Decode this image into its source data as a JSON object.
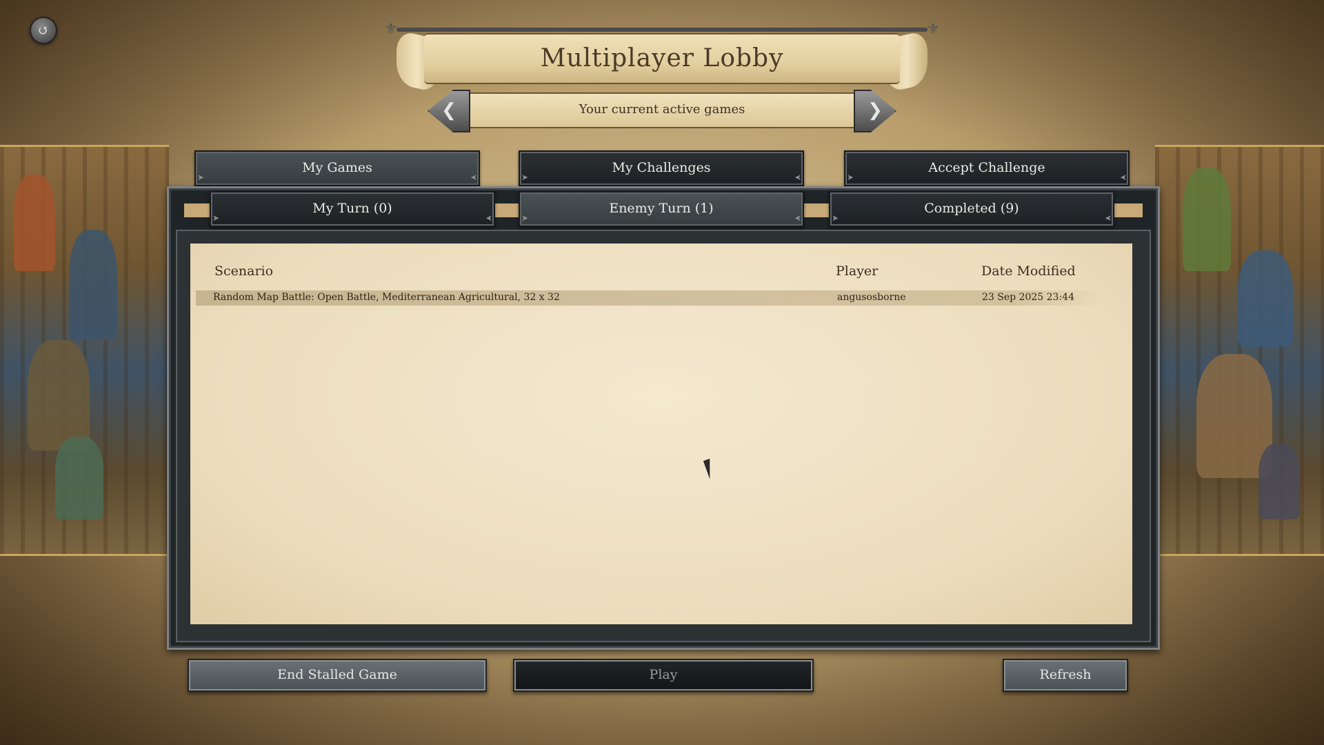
{
  "header": {
    "title": "Multiplayer Lobby",
    "subtitle": "Your current active games"
  },
  "main_tabs": [
    {
      "label": "My Games"
    },
    {
      "label": "My Challenges"
    },
    {
      "label": "Accept Challenge"
    }
  ],
  "sub_tabs": [
    {
      "label": "My Turn (0)"
    },
    {
      "label": "Enemy Turn (1)"
    },
    {
      "label": "Completed (9)"
    }
  ],
  "table": {
    "columns": [
      "Scenario",
      "Player",
      "Date Modified"
    ],
    "rows": [
      {
        "scenario": "Random Map Battle: Open Battle, Mediterranean Agricultural, 32 x 32",
        "player": "angusosborne",
        "date": "23 Sep 2025 23:44"
      }
    ]
  },
  "buttons": {
    "end_stalled": "End Stalled Game",
    "play": "Play",
    "refresh": "Refresh"
  },
  "icons": {
    "back": "back-arrow-icon",
    "prev": "chevron-left-icon",
    "next": "chevron-right-icon"
  }
}
